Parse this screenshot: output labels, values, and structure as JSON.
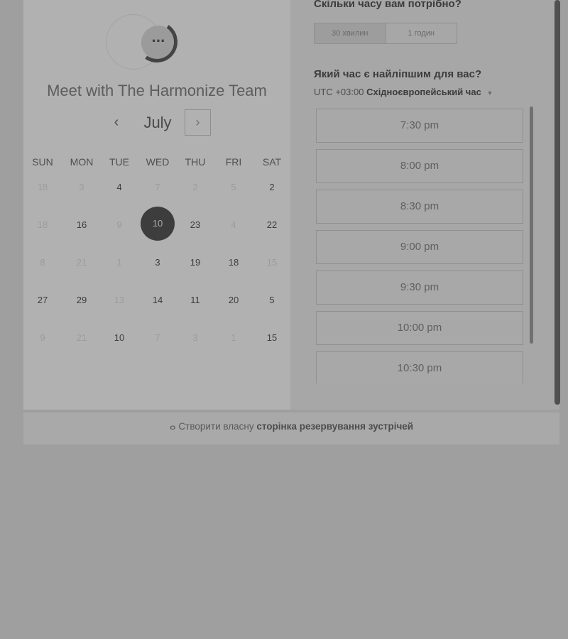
{
  "left": {
    "team_title": "Meet with The Harmonize Team",
    "month": "July",
    "prev_icon": "‹",
    "next_icon": "›",
    "weekdays": [
      "SUN",
      "MON",
      "TUE",
      "WED",
      "THU",
      "FRI",
      "SAT"
    ],
    "weeks": [
      [
        "18",
        "3",
        "4",
        "7",
        "2",
        "5",
        "2"
      ],
      [
        "18",
        "16",
        "9",
        "10",
        "23",
        "4",
        "22"
      ],
      [
        "8",
        "21",
        "1",
        "3",
        "19",
        "18",
        "15"
      ],
      [
        "27",
        "29",
        "13",
        "14",
        "11",
        "20",
        "5"
      ],
      [
        "9",
        "21",
        "10",
        "7",
        "3",
        "1",
        "15"
      ]
    ],
    "muted": [
      [
        true,
        true,
        false,
        true,
        true,
        true,
        false
      ],
      [
        true,
        false,
        true,
        false,
        false,
        true,
        false
      ],
      [
        true,
        true,
        true,
        false,
        false,
        false,
        true
      ],
      [
        false,
        false,
        true,
        false,
        false,
        false,
        false
      ],
      [
        true,
        true,
        false,
        true,
        true,
        true,
        false
      ]
    ],
    "selected_day": "10"
  },
  "right": {
    "duration_question": "Скільки часу вам потрібно?",
    "duration_options": [
      "30 хвилин",
      "1 годин"
    ],
    "time_question": "Який час є найліпшим для вас?",
    "tz_prefix": "UTC +03:00",
    "tz_name": "Східноєвропейський час",
    "slots": [
      "7:30 pm",
      "8:00 pm",
      "8:30 pm",
      "9:00 pm",
      "9:30 pm",
      "10:00 pm",
      "10:30 pm"
    ]
  },
  "footer": {
    "prefix": "Створити власну",
    "bold": "сторінка резервування зустрічей",
    "icon": "hubspot-sprocket-icon"
  }
}
